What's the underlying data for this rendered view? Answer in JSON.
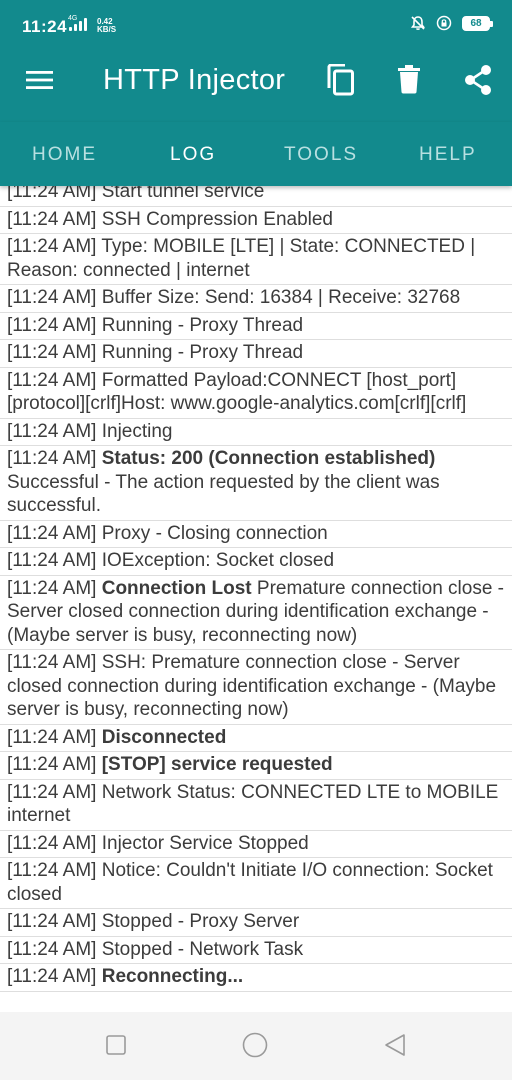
{
  "status_bar": {
    "time": "11:24",
    "network_tiny": "4G",
    "net_speed_value": "0.42",
    "net_speed_unit": "KB/S",
    "battery": "68"
  },
  "toolbar": {
    "title": "HTTP Injector"
  },
  "tabs": [
    {
      "label": "HOME",
      "active": false
    },
    {
      "label": "LOG",
      "active": true
    },
    {
      "label": "TOOLS",
      "active": false
    },
    {
      "label": "HELP",
      "active": false
    }
  ],
  "log": [
    {
      "time": "[11:24 AM]",
      "bold": "",
      "text": "Start tunnel service"
    },
    {
      "time": "[11:24 AM]",
      "bold": "",
      "text": "SSH Compression Enabled"
    },
    {
      "time": "[11:24 AM]",
      "bold": "",
      "text": "Type: MOBILE [LTE] | State: CONNECTED | Reason: connected | internet"
    },
    {
      "time": "[11:24 AM]",
      "bold": "",
      "text": "Buffer Size: Send: 16384 | Receive: 32768"
    },
    {
      "time": "[11:24 AM]",
      "bold": "",
      "text": "Running - Proxy Thread"
    },
    {
      "time": "[11:24 AM]",
      "bold": "",
      "text": "Running - Proxy Thread"
    },
    {
      "time": "[11:24 AM]",
      "bold": "",
      "text": "Formatted Payload:CONNECT [host_port] [protocol][crlf]Host: www.google-analytics.com[crlf][crlf]"
    },
    {
      "time": "[11:24 AM]",
      "bold": "",
      "text": "Injecting"
    },
    {
      "time": "[11:24 AM]",
      "bold": "Status: 200 (Connection established)",
      "text": "Successful - The action requested by the client was successful."
    },
    {
      "time": "[11:24 AM]",
      "bold": "",
      "text": "Proxy - Closing connection"
    },
    {
      "time": "[11:24 AM]",
      "bold": "",
      "text": "IOException: Socket closed"
    },
    {
      "time": "[11:24 AM]",
      "bold": "Connection Lost",
      "text": "Premature connection close - Server closed connection during identification exchange - (Maybe server is busy, reconnecting now)"
    },
    {
      "time": "[11:24 AM]",
      "bold": "",
      "text": "SSH: Premature connection close - Server closed connection during identification exchange - (Maybe server is busy, reconnecting now)"
    },
    {
      "time": "[11:24 AM]",
      "bold": "Disconnected",
      "text": ""
    },
    {
      "time": "[11:24 AM]",
      "bold": "[STOP] service requested",
      "text": ""
    },
    {
      "time": "[11:24 AM]",
      "bold": "",
      "text": "Network Status: CONNECTED LTE to MOBILE internet"
    },
    {
      "time": "[11:24 AM]",
      "bold": "",
      "text": "Injector Service Stopped"
    },
    {
      "time": "[11:24 AM]",
      "bold": "",
      "text": "Notice: Couldn't Initiate I/O connection: Socket closed"
    },
    {
      "time": "[11:24 AM]",
      "bold": "",
      "text": "Stopped - Proxy Server"
    },
    {
      "time": "[11:24 AM]",
      "bold": "",
      "text": "Stopped - Network Task"
    },
    {
      "time": "[11:24 AM]",
      "bold": "Reconnecting...",
      "text": ""
    }
  ],
  "colors": {
    "primary": "#128a8d",
    "tab_inactive": "#b8e0e1",
    "log_text": "#3c3c3c",
    "divider": "#dedede"
  },
  "icons": {
    "menu": "menu-icon",
    "copy": "copy-icon",
    "delete": "trash-icon",
    "share": "share-icon",
    "nav_recent": "square-icon",
    "nav_home": "circle-icon",
    "nav_back": "triangle-back-icon"
  }
}
